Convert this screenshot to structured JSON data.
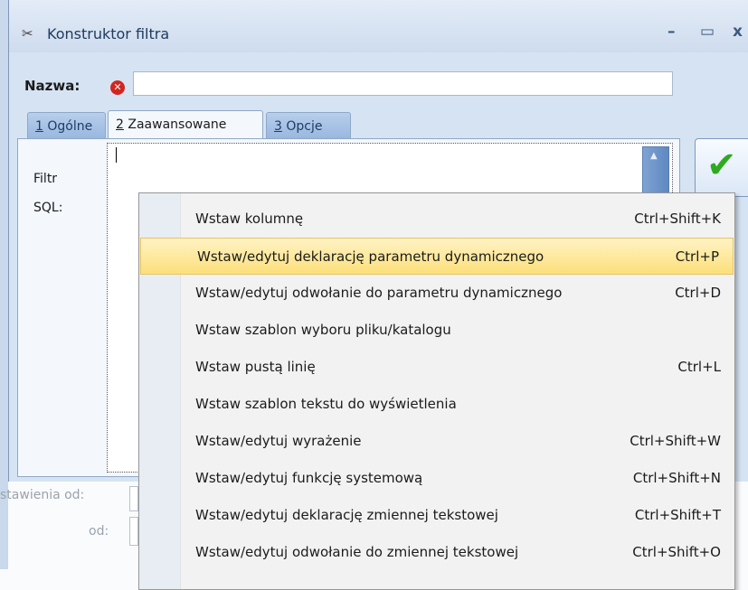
{
  "window": {
    "title": "Konstruktor filtra",
    "minimize_glyph": "–",
    "maximize_glyph": "▭",
    "close_glyph": "x"
  },
  "name_field": {
    "label": "Nazwa:",
    "value": "",
    "error_icon": "error-icon"
  },
  "tabs": [
    {
      "num": "1",
      "label": " Ogólne"
    },
    {
      "num": "2",
      "label": " Zaawansowane"
    },
    {
      "num": "3",
      "label": " Opcje"
    }
  ],
  "editor": {
    "label_line1": "Filtr",
    "label_line2": "SQL:",
    "value": ""
  },
  "ok_button": {
    "icon": "check-icon"
  },
  "background": {
    "label1": "stawienia   od:",
    "label2": "od:"
  },
  "menu": {
    "items": [
      {
        "label": "Wstaw kolumnę",
        "shortcut": "Ctrl+Shift+K"
      },
      {
        "label": "Wstaw/edytuj deklarację parametru dynamicznego",
        "shortcut": "Ctrl+P"
      },
      {
        "label": "Wstaw/edytuj odwołanie do parametru dynamicznego",
        "shortcut": "Ctrl+D"
      },
      {
        "label": "Wstaw szablon wyboru pliku/katalogu",
        "shortcut": ""
      },
      {
        "label": "Wstaw pustą linię",
        "shortcut": "Ctrl+L"
      },
      {
        "label": "Wstaw szablon tekstu do wyświetlenia",
        "shortcut": ""
      },
      {
        "label": "Wstaw/edytuj wyrażenie",
        "shortcut": "Ctrl+Shift+W"
      },
      {
        "label": "Wstaw/edytuj funkcję systemową",
        "shortcut": "Ctrl+Shift+N"
      },
      {
        "label": "Wstaw/edytuj deklarację zmiennej tekstowej",
        "shortcut": "Ctrl+Shift+T"
      },
      {
        "label": "Wstaw/edytuj odwołanie do zmiennej tekstowej",
        "shortcut": "Ctrl+Shift+O"
      }
    ],
    "selected_index": 1
  }
}
